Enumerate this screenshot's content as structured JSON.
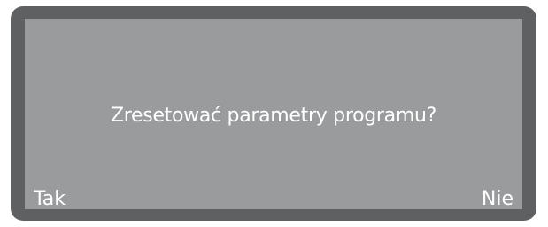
{
  "dialog": {
    "prompt": "Zresetować parametry programu?",
    "left_option": "Tak",
    "right_option": "Nie"
  },
  "colors": {
    "frame": "#5f6061",
    "screen": "#9a9b9d",
    "text": "#ffffff"
  }
}
